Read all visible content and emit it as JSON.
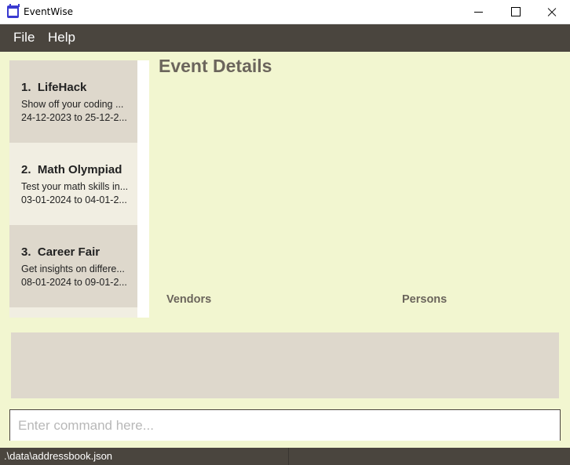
{
  "window": {
    "title": "EventWise"
  },
  "menu": {
    "file": "File",
    "help": "Help"
  },
  "events": [
    {
      "index": "1.",
      "name": "LifeHack",
      "description": "Show off your coding ...",
      "dates": "24-12-2023 to 25-12-2..."
    },
    {
      "index": "2.",
      "name": "Math Olympiad",
      "description": "Test your math skills in...",
      "dates": "03-01-2024 to 04-01-2..."
    },
    {
      "index": "3.",
      "name": "Career Fair",
      "description": "Get insights on differe...",
      "dates": "08-01-2024 to 09-01-2..."
    }
  ],
  "details": {
    "title": "Event Details",
    "vendors_label": "Vendors",
    "persons_label": "Persons"
  },
  "command": {
    "placeholder": "Enter command here..."
  },
  "status": {
    "path": ".\\data\\addressbook.json"
  }
}
